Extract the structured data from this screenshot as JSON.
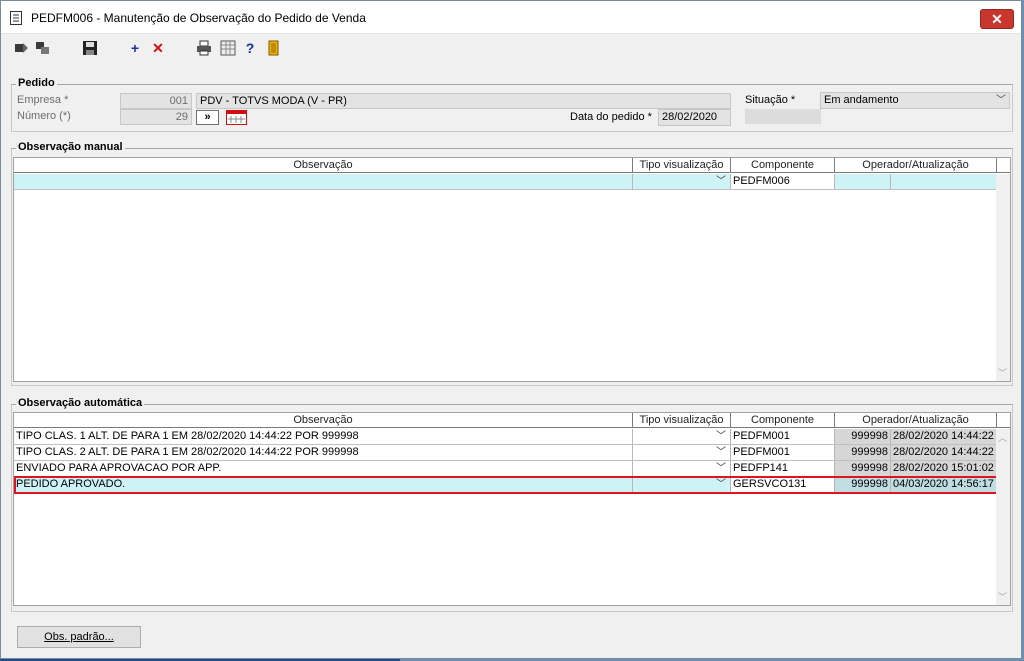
{
  "window": {
    "title": "PEDFM006 - Manutenção de Observação do Pedido de Venda",
    "close_glyph": "✕"
  },
  "toolbar": {
    "icons": [
      "first-record-icon",
      "navigate-icon",
      "save-icon",
      "add-icon",
      "delete-icon",
      "print-icon",
      "calculator-icon",
      "help-icon",
      "exit-icon"
    ],
    "add_glyph": "+",
    "delete_glyph": "✕",
    "help_glyph": "?"
  },
  "pedido": {
    "title": "Pedido",
    "empresa_label": "Empresa *",
    "empresa_code": "001",
    "empresa_name": "PDV - TOTVS MODA (V - PR)",
    "numero_label": "Número (*)",
    "numero_value": "29",
    "nav_button": "»",
    "data_label": "Data do pedido *",
    "data_value": "28/02/2020",
    "situacao_label": "Situação *",
    "situacao_value": "Em andamento"
  },
  "manual": {
    "title": "Observação manual",
    "columns": [
      "Observação",
      "Tipo visualização",
      "Componente",
      "Operador/Atualização"
    ],
    "rows": [
      {
        "observacao": "",
        "tipo": "",
        "componente": "PEDFM006",
        "operador": "",
        "atualizacao": ""
      }
    ]
  },
  "automatica": {
    "title": "Observação automática",
    "columns": [
      "Observação",
      "Tipo visualização",
      "Componente",
      "Operador/Atualização"
    ],
    "rows": [
      {
        "observacao": "TIPO CLAS. 1 ALT. DE  PARA 1 EM 28/02/2020 14:44:22 POR 999998",
        "tipo": "",
        "componente": "PEDFM001",
        "operador": "999998",
        "atualizacao": "28/02/2020 14:44:22"
      },
      {
        "observacao": "TIPO CLAS. 2 ALT. DE  PARA 1 EM 28/02/2020 14:44:22 POR 999998",
        "tipo": "",
        "componente": "PEDFM001",
        "operador": "999998",
        "atualizacao": "28/02/2020 14:44:22"
      },
      {
        "observacao": "ENVIADO PARA APROVACAO POR APP.",
        "tipo": "",
        "componente": "PEDFP141",
        "operador": "999998",
        "atualizacao": "28/02/2020 15:01:02"
      },
      {
        "observacao": "PEDIDO APROVADO.",
        "tipo": "",
        "componente": "GERSVCO131",
        "operador": "999998",
        "atualizacao": "04/03/2020 14:56:17"
      }
    ],
    "selected_row": 3
  },
  "footer": {
    "obs_padrao_button": "Obs. padrão..."
  },
  "colors": {
    "selection": "#cdf3f7",
    "highlight_border": "#e0141e",
    "close": "#c9362b"
  }
}
